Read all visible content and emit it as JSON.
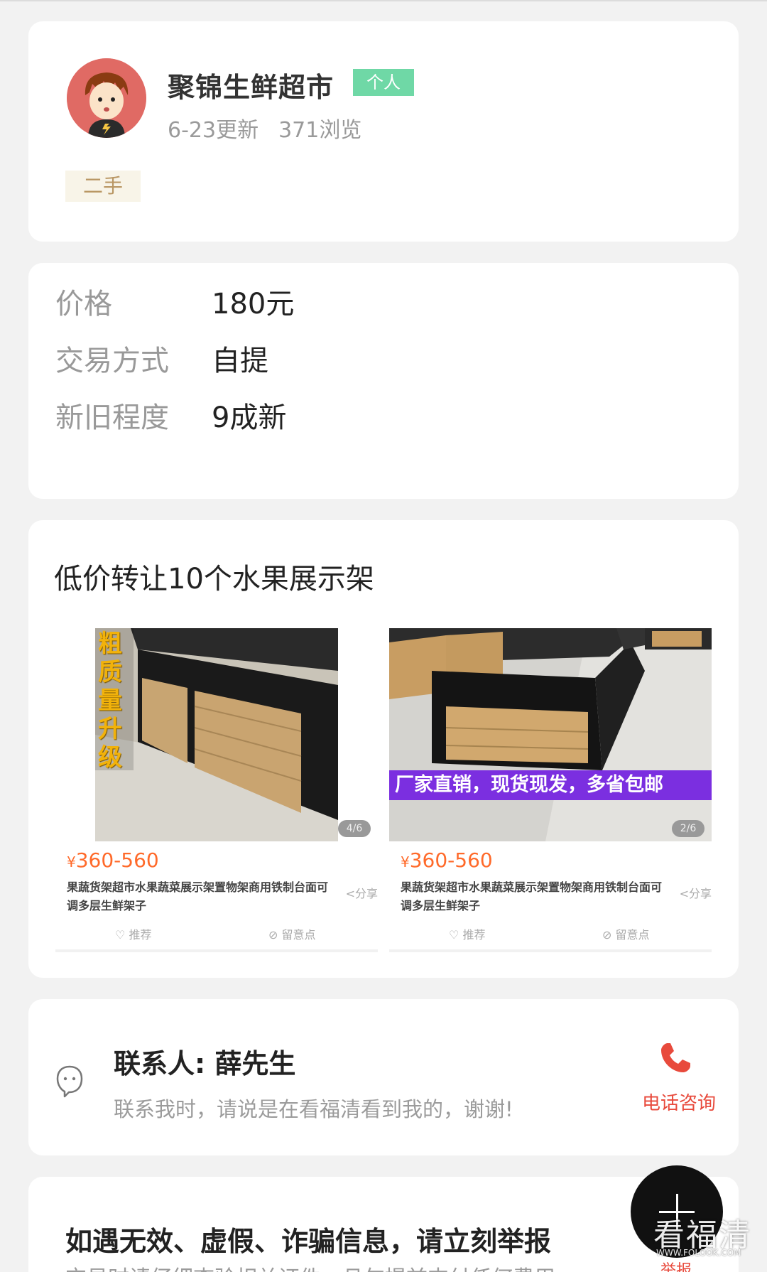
{
  "seller": {
    "name": "聚锦生鲜超市",
    "badge": "个人",
    "updated": "6-23更新",
    "views": "371浏览",
    "tag": "二手"
  },
  "details": {
    "price_label": "价格",
    "price_value": "180元",
    "trade_label": "交易方式",
    "trade_value": "自提",
    "condition_label": "新旧程度",
    "condition_value": "9成新"
  },
  "listing": {
    "title": "低价转让10个水果展示架",
    "products": [
      {
        "overlay_text": "粗质量升级",
        "counter": "4/6",
        "price_symbol": "¥",
        "price": "360-560",
        "desc": "果蔬货架超市水果蔬菜展示架置物架商用铁制台面可调多层生鲜架子",
        "share": "分享",
        "like": "推荐",
        "dislike": "留意点"
      },
      {
        "banner_text": "厂家直销，现货现发，多省包邮",
        "counter": "2/6",
        "price_symbol": "¥",
        "price": "360-560",
        "desc": "果蔬货架超市水果蔬菜展示架置物架商用铁制台面可调多层生鲜架子",
        "share": "分享",
        "like": "推荐",
        "dislike": "留意点"
      }
    ]
  },
  "contact": {
    "name": "联系人: 薛先生",
    "note": "联系我时，请说是在看福清看到我的，谢谢!",
    "phone_label": "电话咨询"
  },
  "report": {
    "title": "如遇无效、虚假、诈骗信息，请立刻举报",
    "subtitle": "交易时请仔细查验相关证件，且勿提前支付任何费用"
  },
  "fab": {
    "label": "举报"
  },
  "watermark": {
    "text": "看福清",
    "url": "WWW.FOLOOK.COM"
  },
  "colors": {
    "accent_red": "#e84a3c",
    "price_orange": "#ff6a2a",
    "badge_green": "#6fd8a6",
    "banner_purple": "#7b2fe0"
  },
  "icons": {
    "avatar": "cartoon-boy-avatar",
    "contact": "chat-bubble-icon",
    "phone": "phone-icon",
    "fab": "plus-icon"
  }
}
